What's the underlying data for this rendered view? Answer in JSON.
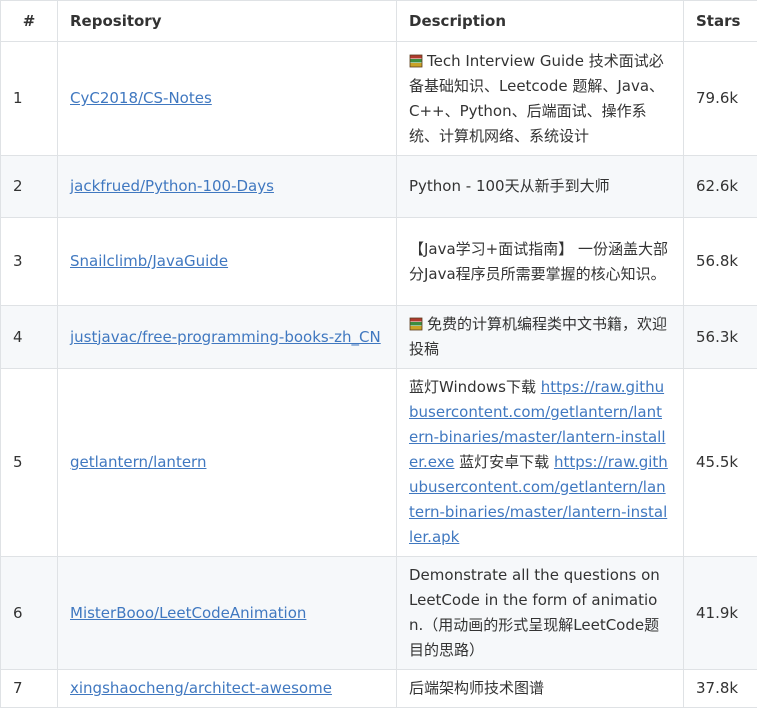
{
  "table": {
    "headers": {
      "index": "#",
      "repository": "Repository",
      "description": "Description",
      "stars": "Stars"
    },
    "rows": [
      {
        "index": "1",
        "repository": "CyC2018/CS-Notes",
        "icon": "books-icon",
        "description": "Tech Interview Guide 技术面试必备基础知识、Leetcode 题解、Java、C++、Python、后端面试、操作系统、计算机网络、系统设计",
        "stars": "79.6k"
      },
      {
        "index": "2",
        "repository": "jackfrued/Python-100-Days",
        "description": "Python - 100天从新手到大师",
        "stars": "62.6k"
      },
      {
        "index": "3",
        "repository": "Snailclimb/JavaGuide",
        "description": "【Java学习+面试指南】 一份涵盖大部分Java程序员所需要掌握的核心知识。",
        "stars": "56.8k"
      },
      {
        "index": "4",
        "repository": "justjavac/free-programming-books-zh_CN",
        "icon": "books-icon",
        "description": "免费的计算机编程类中文书籍，欢迎投稿",
        "stars": "56.3k"
      },
      {
        "index": "5",
        "repository": "getlantern/lantern",
        "desc_text_1": "蓝灯Windows下载 ",
        "desc_link_1": "https://raw.githubusercontent.com/getlantern/lantern-binaries/master/lantern-installer.exe",
        "desc_text_2": " 蓝灯安卓下载 ",
        "desc_link_2": "https://raw.githubusercontent.com/getlantern/lantern-binaries/master/lantern-installer.apk",
        "stars": "45.5k"
      },
      {
        "index": "6",
        "repository": "MisterBooo/LeetCodeAnimation",
        "description": "Demonstrate all the questions on LeetCode in the form of animation.（用动画的形式呈现解LeetCode题目的思路）",
        "stars": "41.9k"
      },
      {
        "index": "7",
        "repository": "xingshaocheng/architect-awesome",
        "description": "后端架构师技术图谱",
        "stars": "37.8k"
      }
    ]
  },
  "colors": {
    "link": "#4078c0",
    "stripe": "#f6f8fa",
    "border": "#dfe2e5",
    "text": "#333333"
  }
}
